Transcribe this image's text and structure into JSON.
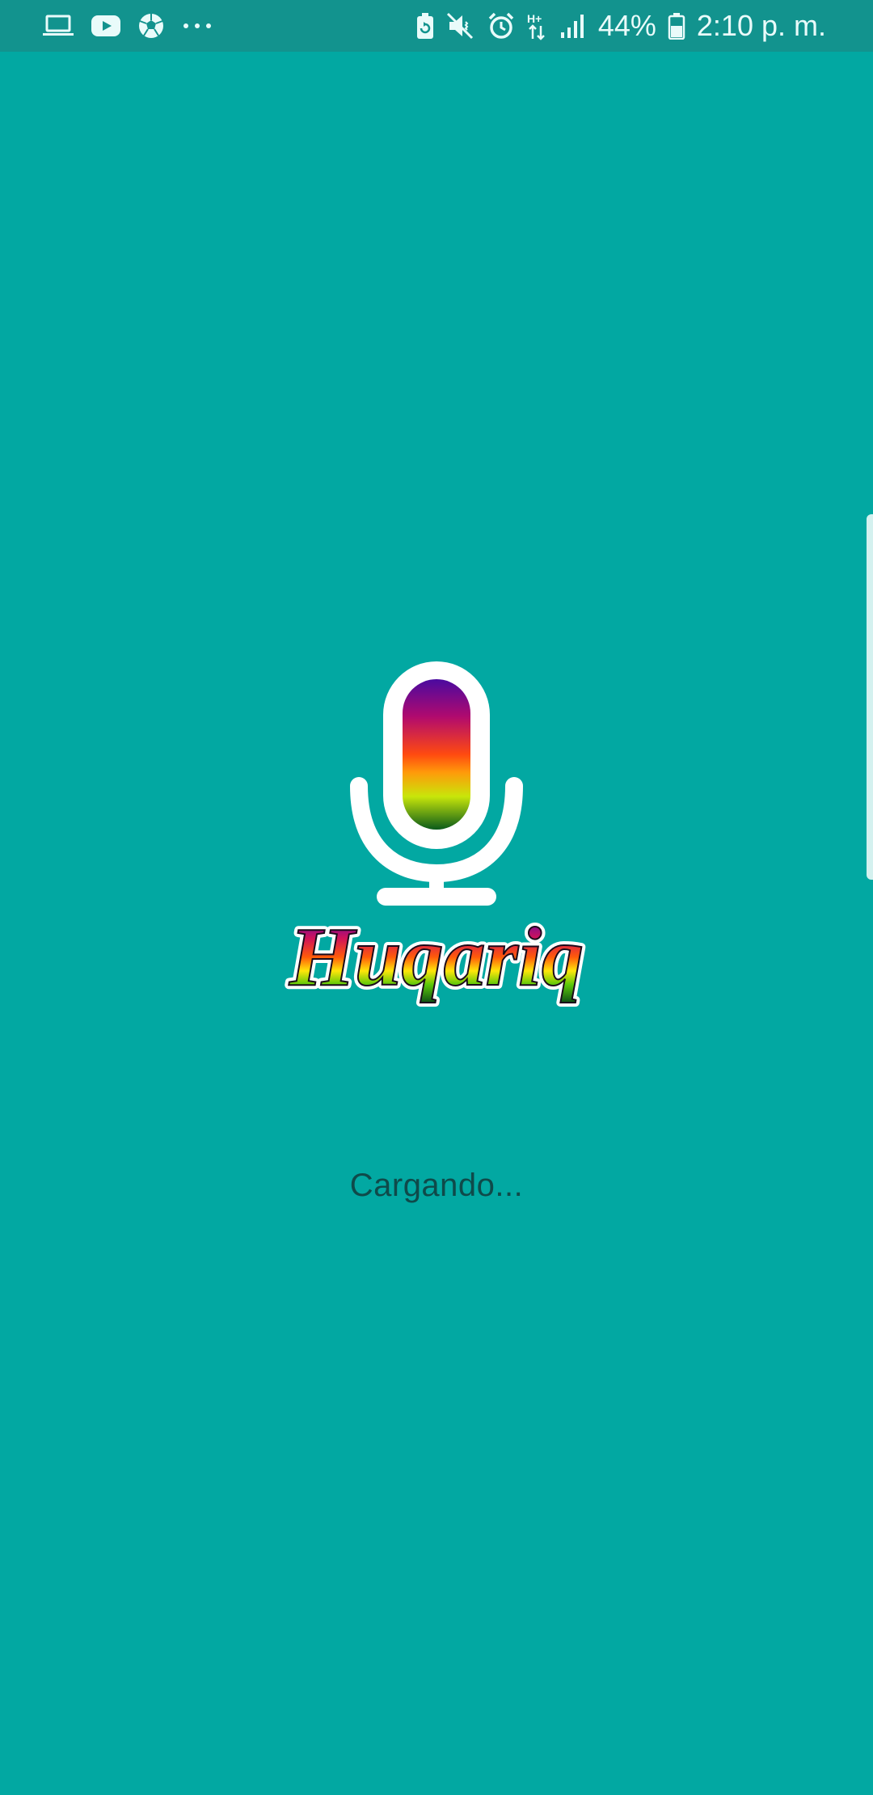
{
  "status_bar": {
    "battery_percent": "44%",
    "time": "2:10 p. m.",
    "network_type": "H+",
    "left_icons": [
      "laptop-icon",
      "youtube-icon",
      "soccer-ball-icon",
      "more-dots-icon"
    ],
    "right_icons": [
      "battery-saver-icon",
      "mute-icon",
      "alarm-icon",
      "network-type-icon",
      "signal-icon",
      "battery-icon"
    ]
  },
  "app": {
    "logo_text": "Huqariq",
    "loading_text": "Cargando..."
  },
  "colors": {
    "background": "#02a8a2",
    "status_bar": "#12938e",
    "loading_text": "#0f4a4a"
  }
}
